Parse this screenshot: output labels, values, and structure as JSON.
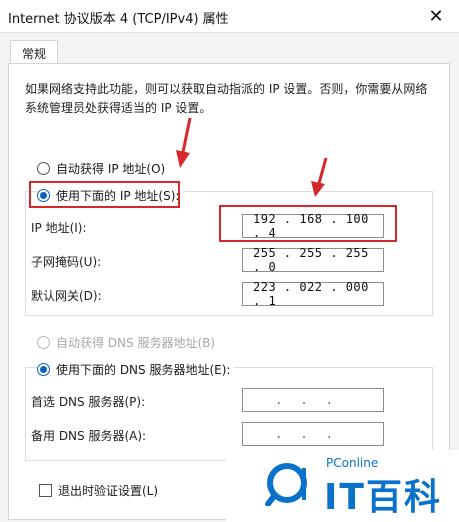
{
  "window": {
    "title": "Internet 协议版本 4 (TCP/IPv4) 属性",
    "close_icon": "✕"
  },
  "tabs": [
    {
      "label": "常规"
    }
  ],
  "description": "如果网络支持此功能，则可以获取自动指派的 IP 设置。否则，你需要从网络系统管理员处获得适当的 IP 设置。",
  "ip": {
    "auto_label": "自动获得 IP 地址(O)",
    "manual_label": "使用下面的 IP 地址(S):",
    "address_label": "IP 地址(I):",
    "address_value": "192 . 168 . 100 . 4",
    "mask_label": "子网掩码(U):",
    "mask_value": "255 . 255 . 255 . 0",
    "gateway_label": "默认网关(D):",
    "gateway_value": "223 . 022 . 000 . 1"
  },
  "dns": {
    "auto_label": "自动获得 DNS 服务器地址(B)",
    "manual_label": "使用下面的 DNS 服务器地址(E):",
    "preferred_label": "首选 DNS 服务器(P):",
    "preferred_value": "...",
    "alternate_label": "备用 DNS 服务器(A):",
    "alternate_value": "..."
  },
  "validate_label": "退出时验证设置(L)",
  "watermark": {
    "small": "PConline",
    "big": "IT百科"
  },
  "colors": {
    "annotation": "#d6282b",
    "brand": "#0a72c9",
    "radio_accent": "#0a5fbf"
  }
}
